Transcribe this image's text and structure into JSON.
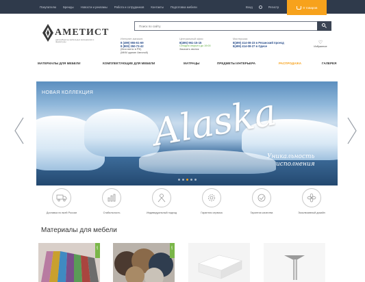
{
  "topbar": {
    "links": [
      "Покупателю",
      "Бренды",
      "Новости и рекламы",
      "Работа и сотрудников",
      "Контакты",
      "Подготовка мебели"
    ],
    "account": "Вход",
    "register": "Регистр",
    "cart_label": "0 товаров"
  },
  "logo": {
    "name": "АМЕТИСТ",
    "tagline": "дистрибьютор мебельных материалов и фурнитуры"
  },
  "search": {
    "placeholder": "Поиск по сайту"
  },
  "contacts": {
    "main": {
      "title": "Интернет-магазин:",
      "phone1": "8 (499) 955-61-69",
      "phone2": "8 (800) 350-73-42",
      "note1": "(бесплатно в РФ)",
      "note2": "(МКМ здание Автопой)"
    },
    "central": {
      "title": "Центральный офис:",
      "phone": "8(495) 961-15-15",
      "status": "Сегодня открыто до 19:00",
      "callback": "Заказать звонок"
    },
    "stores": {
      "title": "Мастерская:",
      "line1": "8(499) 414-08-23 в Рязанский проезд",
      "line2": "8(499) 414-08-27 в Одесе"
    },
    "favorites": "Избранное"
  },
  "nav": {
    "items": [
      "МАТЕРИАЛЫ ДЛЯ МЕБЕЛИ",
      "КОМПЛЕКТУЮЩИЕ ДЛЯ МЕБЕЛИ",
      "МАТРАЦЫ",
      "ПРЕДМЕТЫ ИНТЕРЬЕРА",
      "РАСПРОДАЖА",
      "ГАЛЕРЕЯ"
    ]
  },
  "banner": {
    "collection": "НОВАЯ КОЛЛЕКЦИЯ",
    "title": "Alaska",
    "slogan_line1": "Уникальность",
    "slogan_line2": "исполнения"
  },
  "features": [
    {
      "icon": "truck-icon",
      "caption": "Доставка по всей России"
    },
    {
      "icon": "chart-icon",
      "caption": "Стабильность"
    },
    {
      "icon": "person-icon",
      "caption": "Индивидуальный подход"
    },
    {
      "icon": "gear-icon",
      "caption": "Гарантия сервиса"
    },
    {
      "icon": "check-icon",
      "caption": "Гарантия качества"
    },
    {
      "icon": "fan-icon",
      "caption": "Эксклюзивный дизайн"
    }
  ],
  "section": {
    "title": "Материалы для мебели"
  },
  "products": {
    "badge": "ХИТ"
  },
  "colors": {
    "accent": "#f7a21c",
    "topbar": "#2f3a4b",
    "link": "#2b4f8c",
    "success": "#5aa93a"
  }
}
